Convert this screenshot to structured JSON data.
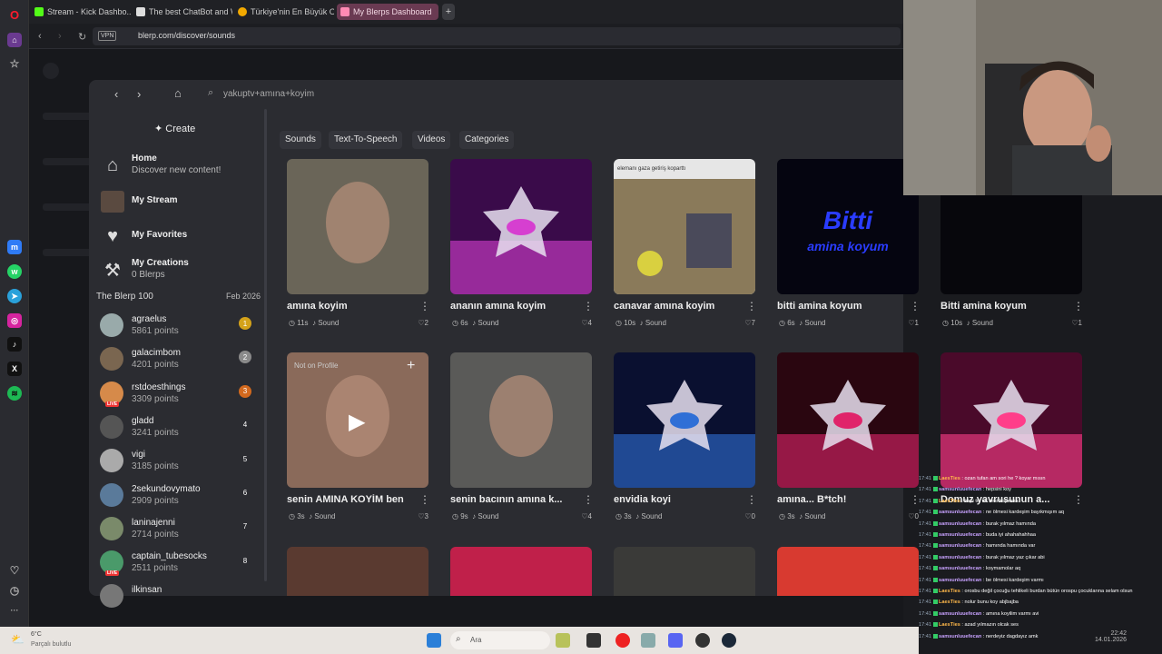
{
  "browser": {
    "tabs": [
      {
        "label": "Stream - Kick Dashbo...",
        "color": "#53fc18"
      },
      {
        "label": "The best ChatBot and Wi...",
        "color": "#dddddd"
      },
      {
        "label": "Türkiye'nin En Büyük Oyun...",
        "color": "#f2a900"
      },
      {
        "label": "My Blerps Dashboard",
        "color": "#ff8ab4"
      }
    ],
    "vpn_label": "VPN",
    "url": "blerp.com/discover/sounds"
  },
  "modal": {
    "search_query": "yakuptv+amına+koyim",
    "create_label": "Create",
    "nav": [
      {
        "title": "Home",
        "subtitle": "Discover new content!",
        "icon": "home-icon"
      },
      {
        "title": "My Stream",
        "subtitle": "",
        "icon": "stream-avatar-icon"
      },
      {
        "title": "My Favorites",
        "subtitle": "",
        "icon": "heart-icon"
      },
      {
        "title": "My Creations",
        "subtitle": "0 Blerps",
        "icon": "hammer-icon"
      }
    ],
    "leaderboard_title": "The Blerp 100",
    "leaderboard_date": "Feb 2026",
    "leaderboard": [
      {
        "name": "agraelus",
        "points": "5861 points",
        "rank": "1",
        "live": false,
        "rank_color": "#d4a21a"
      },
      {
        "name": "galacimbom",
        "points": "4201 points",
        "rank": "2",
        "live": false,
        "rank_color": "#8a8a8a"
      },
      {
        "name": "rstdoesthings",
        "points": "3309 points",
        "rank": "3",
        "live": true,
        "rank_color": "#d2691e"
      },
      {
        "name": "gladd",
        "points": "3241 points",
        "rank": "4",
        "live": false,
        "rank_color": ""
      },
      {
        "name": "vigi",
        "points": "3185 points",
        "rank": "5",
        "live": false,
        "rank_color": ""
      },
      {
        "name": "2sekundovymato",
        "points": "2909 points",
        "rank": "6",
        "live": false,
        "rank_color": ""
      },
      {
        "name": "laninajenni",
        "points": "2714 points",
        "rank": "7",
        "live": false,
        "rank_color": ""
      },
      {
        "name": "captain_tubesocks",
        "points": "2511 points",
        "rank": "8",
        "live": true,
        "rank_color": ""
      },
      {
        "name": "ilkinsan",
        "points": "",
        "rank": "",
        "live": false,
        "rank_color": ""
      }
    ],
    "live_label": "LIVE",
    "filters": [
      "Sounds",
      "Text-To-Speech",
      "Videos",
      "Categories"
    ],
    "cards": [
      {
        "title": "amına koyim",
        "duration": "11s",
        "type": "Sound",
        "likes": "2",
        "thumb": "photo-man-car"
      },
      {
        "title": "ananın amına koyim",
        "duration": "6s",
        "type": "Sound",
        "likes": "4",
        "thumb": "blerp-logo-purple"
      },
      {
        "title": "canavar amına koyim",
        "duration": "10s",
        "type": "Sound",
        "likes": "7",
        "thumb": "photo-market",
        "caption": "elemanı gaza getiriş koparttı"
      },
      {
        "title": "bitti amina koyum",
        "duration": "6s",
        "type": "Sound",
        "likes": "1",
        "thumb": "text-bitti",
        "thumb_text": "Bitti",
        "thumb_text2": "amina koyum"
      },
      {
        "title": "Bitti amina koyum",
        "duration": "10s",
        "type": "Sound",
        "likes": "1",
        "thumb": "dark"
      },
      {
        "title": "senin AMINA KOYİM ben",
        "duration": "3s",
        "type": "Sound",
        "likes": "3",
        "thumb": "photo-woman",
        "badge": "Not on Profile"
      },
      {
        "title": "senin bacının amına k...",
        "duration": "9s",
        "type": "Sound",
        "likes": "4",
        "thumb": "photo-man-face"
      },
      {
        "title": "envidia koyi",
        "duration": "3s",
        "type": "Sound",
        "likes": "0",
        "thumb": "blerp-logo-blue"
      },
      {
        "title": "amına... B*tch!",
        "duration": "3s",
        "type": "Sound",
        "likes": "0",
        "thumb": "blerp-logo-red"
      },
      {
        "title": "Domuz yavrusunun a...",
        "duration": "",
        "type": "",
        "likes": "",
        "thumb": "blerp-logo-pink"
      }
    ]
  },
  "chat": [
    {
      "time": "17:41",
      "user": "LaesTies",
      "msg": "ozan tufan am sori he ? koyar mısın",
      "orange": true
    },
    {
      "time": "17:41",
      "user": "samsunluuefecan",
      "msg": "hepsini koy",
      "orange": false
    },
    {
      "time": "17:41",
      "user": "LaesTies",
      "msg": "kapi tık tık sesi koysana",
      "orange": true
    },
    {
      "time": "17:41",
      "user": "samsunluuefecan",
      "msg": "ne ölmesi kardeşim bayıkmışım aq",
      "orange": false
    },
    {
      "time": "17:41",
      "user": "samsunluuefecan",
      "msg": "burak yılmaz hamında",
      "orange": false
    },
    {
      "time": "17:41",
      "user": "samsunluuefecan",
      "msg": "buda iyi ahahahahhaa",
      "orange": false
    },
    {
      "time": "17:41",
      "user": "samsunluuefecan",
      "msg": "hamında hamında var",
      "orange": false
    },
    {
      "time": "17:41",
      "user": "samsunluuefecan",
      "msg": "burak yılmaz yaz çıkar abi",
      "orange": false
    },
    {
      "time": "17:41",
      "user": "samsunluuefecan",
      "msg": "koymamolar aq",
      "orange": false
    },
    {
      "time": "17:41",
      "user": "samsunluuefecan",
      "msg": "be ölmesi kardeşim varmı",
      "orange": false
    },
    {
      "time": "17:41",
      "user": "LaesTies",
      "msg": "orosbu değil çocuğu tehlikeli burdan bütün orospu çocuklarına selam olsun",
      "orange": true
    },
    {
      "time": "17:41",
      "user": "LaesTies",
      "msg": "nolur bunu koy abjbajba",
      "orange": true
    },
    {
      "time": "17:41",
      "user": "samsunluuefecan",
      "msg": "amına koyilim varmı avi",
      "orange": false
    },
    {
      "time": "17:41",
      "user": "LaesTies",
      "msg": "azad yılmazın olcak ses",
      "orange": true
    },
    {
      "time": "17:41",
      "user": "samsunluuefecan",
      "msg": "nerdeyiz dagdayız amk",
      "orange": false
    }
  ],
  "taskbar": {
    "weather_temp": "6°C",
    "weather_desc": "Parçalı bulutlu",
    "search_placeholder": "Ara",
    "clock": "22:42",
    "date": "14.01.2026"
  }
}
